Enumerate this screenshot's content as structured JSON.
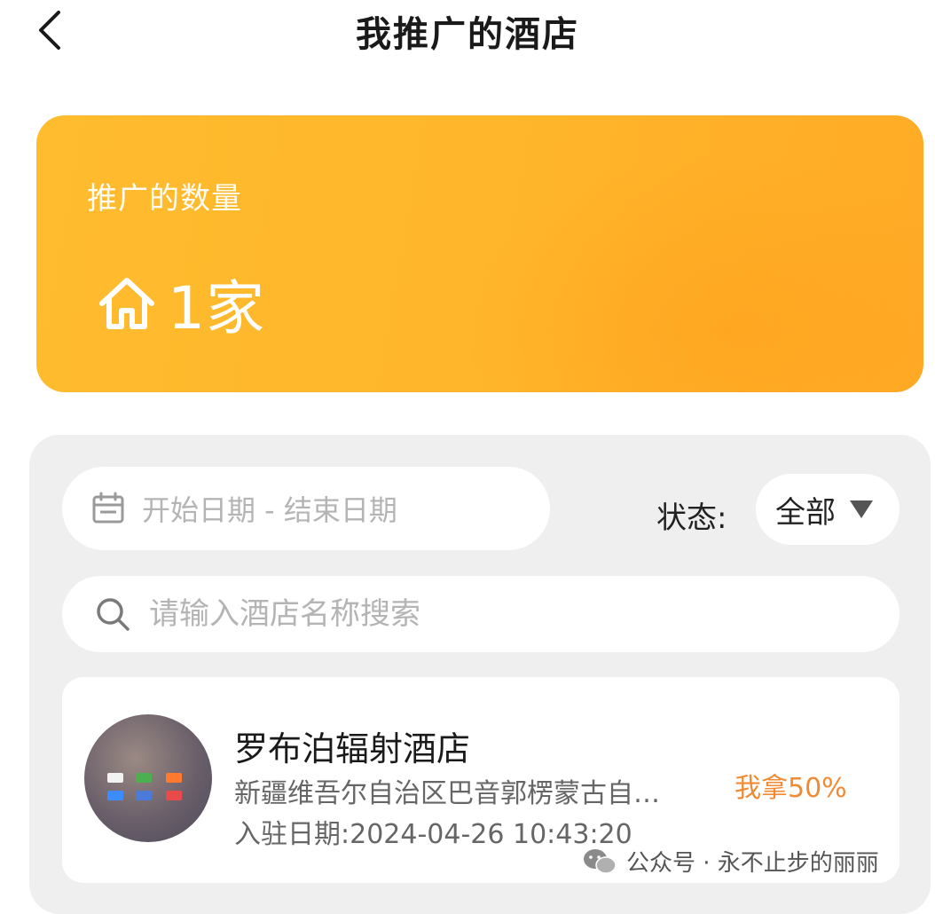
{
  "header": {
    "title": "我推广的酒店",
    "back_icon": "chevron-left-icon"
  },
  "summary": {
    "label": "推广的数量",
    "value": "1家",
    "icon": "home-icon",
    "colors": {
      "gradient_start": "#ffbc2e",
      "gradient_end": "#ffaa26"
    }
  },
  "filters": {
    "date_range_placeholder": "开始日期 - 结束日期",
    "calendar_icon": "calendar-icon",
    "status_label": "状态:",
    "status_value": "全部",
    "search_placeholder": "请输入酒店名称搜索",
    "search_icon": "search-icon"
  },
  "hotels": [
    {
      "name": "罗布泊辐射酒店",
      "address": "新疆维吾尔自治区巴音郭楞蒙古自…",
      "join_date": "入驻日期:2024-04-26 10:43:20",
      "commission": "我拿50%",
      "commission_color": "#f08a33"
    }
  ],
  "watermark": {
    "text": "公众号 · 永不止步的丽丽",
    "icon": "wechat-icon"
  }
}
